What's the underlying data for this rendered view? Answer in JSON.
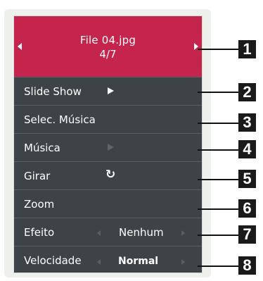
{
  "header": {
    "file_name": "File 04.jpg",
    "position": "4/7"
  },
  "menu": {
    "slide_show": "Slide Show",
    "select_music": "Selec. Música",
    "music": "Música",
    "rotate": "Girar",
    "rotate_icon": "↻",
    "zoom": "Zoom",
    "effect": "Efeito",
    "effect_value": "Nenhum",
    "speed": "Velocidade",
    "speed_value": "Normal"
  },
  "callouts": [
    "1",
    "2",
    "3",
    "4",
    "5",
    "6",
    "7",
    "8"
  ],
  "colors": {
    "header_bg": "#c5244c",
    "panel_bg": "#3e4347",
    "frame_bg": "#eef0ec",
    "badge_bg": "#1a1a1a"
  }
}
